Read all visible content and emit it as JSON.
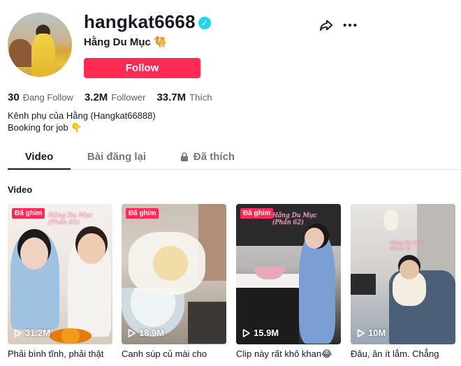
{
  "profile": {
    "username": "hangkat6668",
    "nickname": "Hằng Du Mục 🐫",
    "follow_label": "Follow",
    "bio_line1": "Kênh phụ của Hằng (Hangkat66888)",
    "bio_line2": "Booking for job 👇"
  },
  "stats": {
    "following_count": "30",
    "following_label": "Đang Follow",
    "followers_count": "3.2M",
    "followers_label": "Follower",
    "likes_count": "33.7M",
    "likes_label": "Thích"
  },
  "tabs": [
    {
      "label": "Video",
      "active": true
    },
    {
      "label": "Bài đăng lại",
      "active": false
    },
    {
      "label": "Đã thích",
      "active": false,
      "icon": "lock-icon"
    }
  ],
  "section_title": "Video",
  "videos": [
    {
      "pinned": "Đã ghim",
      "views": "31.2M",
      "caption": "Phải bình tĩnh, phải thật"
    },
    {
      "pinned": "Đã ghim",
      "views": "18.9M",
      "caption": "Canh súp củ mài cho"
    },
    {
      "pinned": "Đã ghim",
      "views": "15.9M",
      "caption": "Clip này rất khô khan😂"
    },
    {
      "pinned": "",
      "views": "10M",
      "caption": "Đâu, ăn ít lắm. Chẳng"
    }
  ],
  "colors": {
    "accent": "#fe2c55",
    "verified": "#20d5ec",
    "text": "#161823",
    "muted": "#75777f"
  }
}
